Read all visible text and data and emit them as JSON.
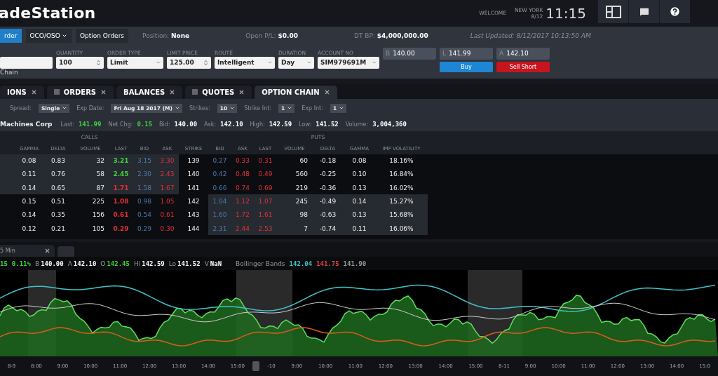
{
  "header": {
    "logo": "adeStation",
    "welcome": "WELCOME",
    "city": "NEW YORK",
    "date": "8/12",
    "time": "11:15"
  },
  "order_bar": {
    "tabs": [
      {
        "label": "rder",
        "selected": true,
        "dropdown": false
      },
      {
        "label": "OCO/OSO",
        "selected": false,
        "dropdown": true
      },
      {
        "label": "Option Orders",
        "selected": false,
        "dropdown": false
      }
    ],
    "stats": [
      {
        "label": "Position:",
        "value": "None"
      },
      {
        "label": "Open P/L:",
        "value": "$0.00"
      },
      {
        "label": "DT BP:",
        "value": "$4,000,000.00"
      }
    ],
    "last_updated": "Last Updated: 8/12/2017 10:13:50 AM",
    "fields": [
      {
        "kind": "symbol"
      },
      {
        "kind": "spinner",
        "label": "QUANTITY",
        "value": "100"
      },
      {
        "kind": "select",
        "label": "ORDER TYPE",
        "value": "Limit"
      },
      {
        "kind": "spinner",
        "label": "LIMIT PRICE",
        "value": "125.00"
      },
      {
        "kind": "select",
        "label": "ROUTE",
        "value": "Intelligent"
      },
      {
        "kind": "select",
        "label": "DURATION",
        "value": "Day"
      },
      {
        "kind": "select",
        "label": "ACCOUNT NO",
        "value": "SIM979691M"
      },
      {
        "kind": "quote",
        "prefix": "B",
        "value": "140.00"
      },
      {
        "kind": "quote",
        "prefix": "L",
        "value": "141.99",
        "button": {
          "label": "Buy",
          "kind": "buy"
        }
      },
      {
        "kind": "quote",
        "prefix": "A",
        "value": "142.10",
        "button": {
          "label": "Sell Short",
          "kind": "sell"
        }
      }
    ],
    "link": "Chain"
  },
  "tabs": [
    {
      "label": "IONS",
      "selected": false,
      "has_icon": false
    },
    {
      "label": "ORDERS",
      "selected": false,
      "has_icon": true
    },
    {
      "label": "BALANCES",
      "selected": false,
      "has_icon": false
    },
    {
      "label": "QUOTES",
      "selected": false,
      "has_icon": true
    },
    {
      "label": "OPTION CHAIN",
      "selected": true,
      "has_icon": false
    }
  ],
  "filters": [
    {
      "label": "Spread:",
      "value": "Single"
    },
    {
      "label": "Exp Date:",
      "value": "Fri Aug 18 2017 (M)"
    },
    {
      "label": "Strikes:",
      "value": "10"
    },
    {
      "label": "Strike Int:",
      "value": "1"
    },
    {
      "label": "Exp Int:",
      "value": "1"
    }
  ],
  "quote": {
    "name": "Machines Corp",
    "items": [
      {
        "label": "Last:",
        "value": "141.99",
        "color": "#3fd23f"
      },
      {
        "label": "Net Chg:",
        "value": "0.15",
        "color": "#3fd23f"
      },
      {
        "label": "Bid:",
        "value": "140.00",
        "color": "#ffffff"
      },
      {
        "label": "Ask:",
        "value": "142.10",
        "color": "#ffffff"
      },
      {
        "label": "High:",
        "value": "142.59",
        "color": "#ffffff"
      },
      {
        "label": "Low:",
        "value": "141.52",
        "color": "#ffffff"
      },
      {
        "label": "Volume:",
        "value": "3,004,360",
        "color": "#ffffff"
      }
    ]
  },
  "chain": {
    "calls_title": "CALLS",
    "puts_title": "PUTS",
    "columns": [
      "GAMMA",
      "DELTA",
      "VOLUME",
      "LAST",
      "BID",
      "ASK",
      "STRIKE",
      "BID",
      "ASK",
      "LAST",
      "VOLUME",
      "DELTA",
      "GAMMA",
      "IMP VOLATILITY"
    ],
    "rows": [
      {
        "calls_itm": true,
        "puts_itm": false,
        "color": "#3fd23f",
        "cells": [
          "0.08",
          "0.83",
          "32",
          "3.21",
          "3.15",
          "3.30",
          "139",
          "0.27",
          "0.33",
          "0.31",
          "60",
          "-0.18",
          "0.08",
          "18.16%"
        ]
      },
      {
        "calls_itm": true,
        "puts_itm": false,
        "color": "#3fd23f",
        "cells": [
          "0.11",
          "0.76",
          "58",
          "2.45",
          "2.30",
          "2.43",
          "140",
          "0.42",
          "0.48",
          "0.49",
          "560",
          "-0.25",
          "0.10",
          "16.84%"
        ]
      },
      {
        "calls_itm": true,
        "puts_itm": false,
        "color": "#e0303a",
        "cells": [
          "0.14",
          "0.65",
          "87",
          "1.71",
          "1.58",
          "1.67",
          "141",
          "0.66",
          "0.74",
          "0.69",
          "219",
          "-0.36",
          "0.13",
          "16.02%"
        ]
      },
      {
        "calls_itm": false,
        "puts_itm": true,
        "color": "#e0303a",
        "cells": [
          "0.15",
          "0.51",
          "225",
          "1.08",
          "0.98",
          "1.05",
          "142",
          "1.04",
          "1.12",
          "1.07",
          "245",
          "-0.49",
          "0.14",
          "15.27%"
        ]
      },
      {
        "calls_itm": false,
        "puts_itm": true,
        "color": "#e0303a",
        "cells": [
          "0.14",
          "0.35",
          "156",
          "0.61",
          "0.54",
          "0.61",
          "143",
          "1.60",
          "1.72",
          "1.61",
          "98",
          "-0.63",
          "0.13",
          "15.68%"
        ]
      },
      {
        "calls_itm": false,
        "puts_itm": true,
        "color": "#e0303a",
        "cells": [
          "0.12",
          "0.21",
          "105",
          "0.29",
          "0.29",
          "0.30",
          "144",
          "2.31",
          "2.44",
          "2.53",
          "7",
          "-0.74",
          "0.11",
          "16.06%"
        ]
      }
    ]
  },
  "chart": {
    "tab": "5 Min",
    "info": [
      {
        "value": "15",
        "color": "#3fd23f"
      },
      {
        "value": "0.11%",
        "color": "#3fd23f"
      },
      {
        "label": "B",
        "value": "140.00",
        "color": "#ffffff"
      },
      {
        "label": "A",
        "value": "142.10",
        "color": "#ffffff"
      },
      {
        "label": "O",
        "value": "142.45",
        "color": "#3fd23f"
      },
      {
        "label": "Hi",
        "value": "142.59",
        "color": "#ffffff"
      },
      {
        "label": "Lo",
        "value": "141.52",
        "color": "#ffffff"
      },
      {
        "label": "V",
        "value": "NaN",
        "color": "#ffffff"
      }
    ],
    "bands": {
      "label": "Bollinger Bands",
      "values": [
        {
          "value": "142.04",
          "color": "#3fc4c8"
        },
        {
          "value": "141.75",
          "color": "#e0404a"
        },
        {
          "value": "141.90",
          "color": "#9a9a9a"
        }
      ]
    },
    "axis": [
      [
        "8-9",
        "8:00",
        "9:00",
        "10:00",
        "11:00",
        "12:00",
        "13:00",
        "14:00",
        "15:00"
      ],
      [
        "-10",
        "9:00",
        "10:00",
        "11:00",
        "12:00",
        "13:00",
        "14:00",
        "15:00"
      ],
      [
        "8-11",
        "9:00",
        "10:00",
        "11:00",
        "12:00",
        "13:00",
        "14:00",
        "15:0"
      ]
    ]
  }
}
